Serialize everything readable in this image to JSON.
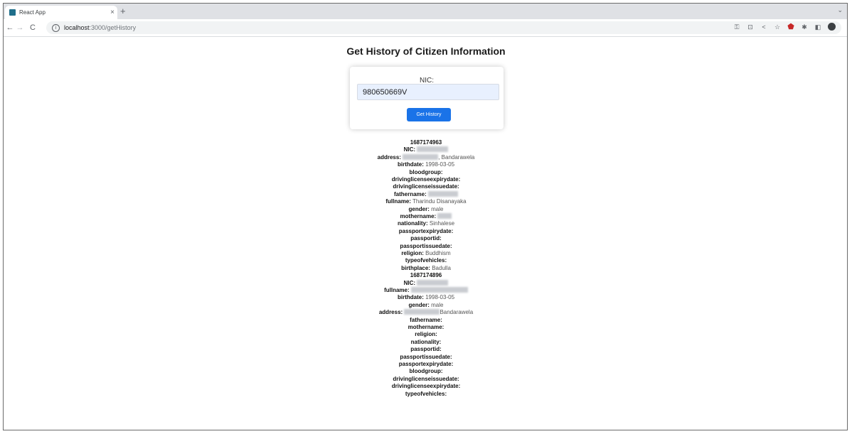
{
  "browser": {
    "tab_title": "React App",
    "tab_close": "×",
    "new_tab": "+",
    "url_host": "localhost",
    "url_path": ":3000/getHistory"
  },
  "page": {
    "title": "Get History of Citizen Information",
    "form": {
      "nic_label": "NIC:",
      "nic_value": "980650669V",
      "button_label": "Get History"
    }
  },
  "history": [
    {
      "timestamp": "1687174963",
      "fields": [
        {
          "label": "NIC:",
          "value": "",
          "redacted": true
        },
        {
          "label": "address:",
          "value": ", Bandarawela",
          "redacted": true
        },
        {
          "label": "birthdate:",
          "value": "1998-03-05",
          "redacted": false
        },
        {
          "label": "bloodgroup:",
          "value": "",
          "redacted": false
        },
        {
          "label": "drivinglicenseexpirydate:",
          "value": "",
          "redacted": false
        },
        {
          "label": "drivinglicenseissuedate:",
          "value": "",
          "redacted": false
        },
        {
          "label": "fathername:",
          "value": "",
          "redacted": true
        },
        {
          "label": "fullname:",
          "value": "Tharindu Disanayaka",
          "redacted": false
        },
        {
          "label": "gender:",
          "value": "male",
          "redacted": false
        },
        {
          "label": "mothername:",
          "value": "",
          "redacted": true
        },
        {
          "label": "nationality:",
          "value": "Sinhalese",
          "redacted": false
        },
        {
          "label": "passportexpirydate:",
          "value": "",
          "redacted": false
        },
        {
          "label": "passportid:",
          "value": "",
          "redacted": false
        },
        {
          "label": "passportissuedate:",
          "value": "",
          "redacted": false
        },
        {
          "label": "religion:",
          "value": "Buddhism",
          "redacted": false
        },
        {
          "label": "typeofvehicles:",
          "value": "",
          "redacted": false
        },
        {
          "label": "birthplace:",
          "value": "Badulla",
          "redacted": false
        }
      ]
    },
    {
      "timestamp": "1687174896",
      "fields": [
        {
          "label": "NIC:",
          "value": "",
          "redacted": true
        },
        {
          "label": "fullname:",
          "value": "",
          "redacted": true
        },
        {
          "label": "birthdate:",
          "value": "1998-03-05",
          "redacted": false
        },
        {
          "label": "gender:",
          "value": "male",
          "redacted": false
        },
        {
          "label": "address:",
          "value": "Bandarawela",
          "redacted": true
        },
        {
          "label": "fathername:",
          "value": "",
          "redacted": false
        },
        {
          "label": "mothername:",
          "value": "",
          "redacted": false
        },
        {
          "label": "religion:",
          "value": "",
          "redacted": false
        },
        {
          "label": "nationality:",
          "value": "",
          "redacted": false
        },
        {
          "label": "passportid:",
          "value": "",
          "redacted": false
        },
        {
          "label": "passportissuedate:",
          "value": "",
          "redacted": false
        },
        {
          "label": "passportexpirydate:",
          "value": "",
          "redacted": false
        },
        {
          "label": "bloodgroup:",
          "value": "",
          "redacted": false
        },
        {
          "label": "drivinglicenseissuedate:",
          "value": "",
          "redacted": false
        },
        {
          "label": "drivinglicenseexpirydate:",
          "value": "",
          "redacted": false
        },
        {
          "label": "typeofvehicles:",
          "value": "",
          "redacted": false
        }
      ]
    }
  ]
}
